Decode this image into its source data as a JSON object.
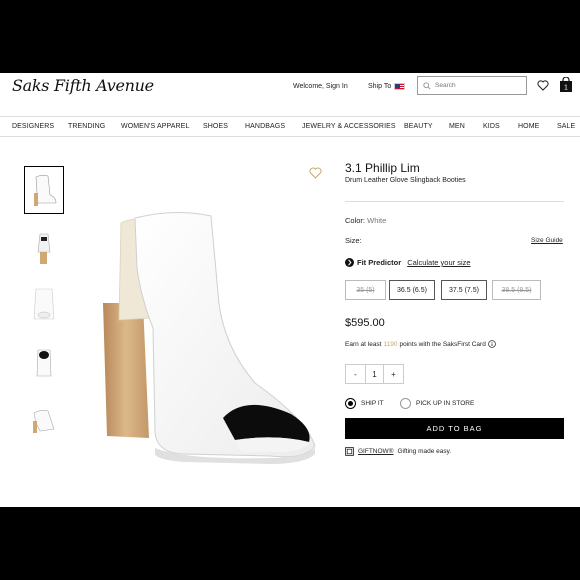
{
  "header": {
    "logo": "Saks Fifth Avenue",
    "welcome": "Welcome, Sign In",
    "ship_to": "Ship To",
    "search_placeholder": "Search",
    "bag_count": "1"
  },
  "nav": [
    "DESIGNERS",
    "TRENDING",
    "WOMEN'S APPAREL",
    "SHOES",
    "HANDBAGS",
    "JEWELRY & ACCESSORIES",
    "BEAUTY",
    "MEN",
    "KIDS",
    "HOME",
    "SALE"
  ],
  "product": {
    "brand": "3.1 Phillip Lim",
    "name": "Drum Leather Glove Slingback Booties",
    "color_label": "Color:",
    "color_value": "White",
    "size_label": "Size:",
    "size_guide": "Size Guide",
    "fit_predictor": "Fit Predictor",
    "calc_size": "Calculate your size",
    "sizes": [
      "35 (5)",
      "36.5 (6.5)",
      "37.5 (7.5)",
      "38.5 (8.5)"
    ],
    "price": "$595.00",
    "earn_prefix": "Earn at least",
    "earn_points": "1190",
    "earn_suffix": "points with the SaksFirst Card",
    "qty_minus": "-",
    "qty_value": "1",
    "qty_plus": "+",
    "ship_it": "SHIP IT",
    "pick_up": "PICK UP IN STORE",
    "add_to_bag": "ADD TO BAG",
    "giftnow": "GIFTNOW®",
    "giftnow_text": "Gifting made easy."
  },
  "colors": {
    "accent": "#c9a86a",
    "primary": "#000000"
  }
}
